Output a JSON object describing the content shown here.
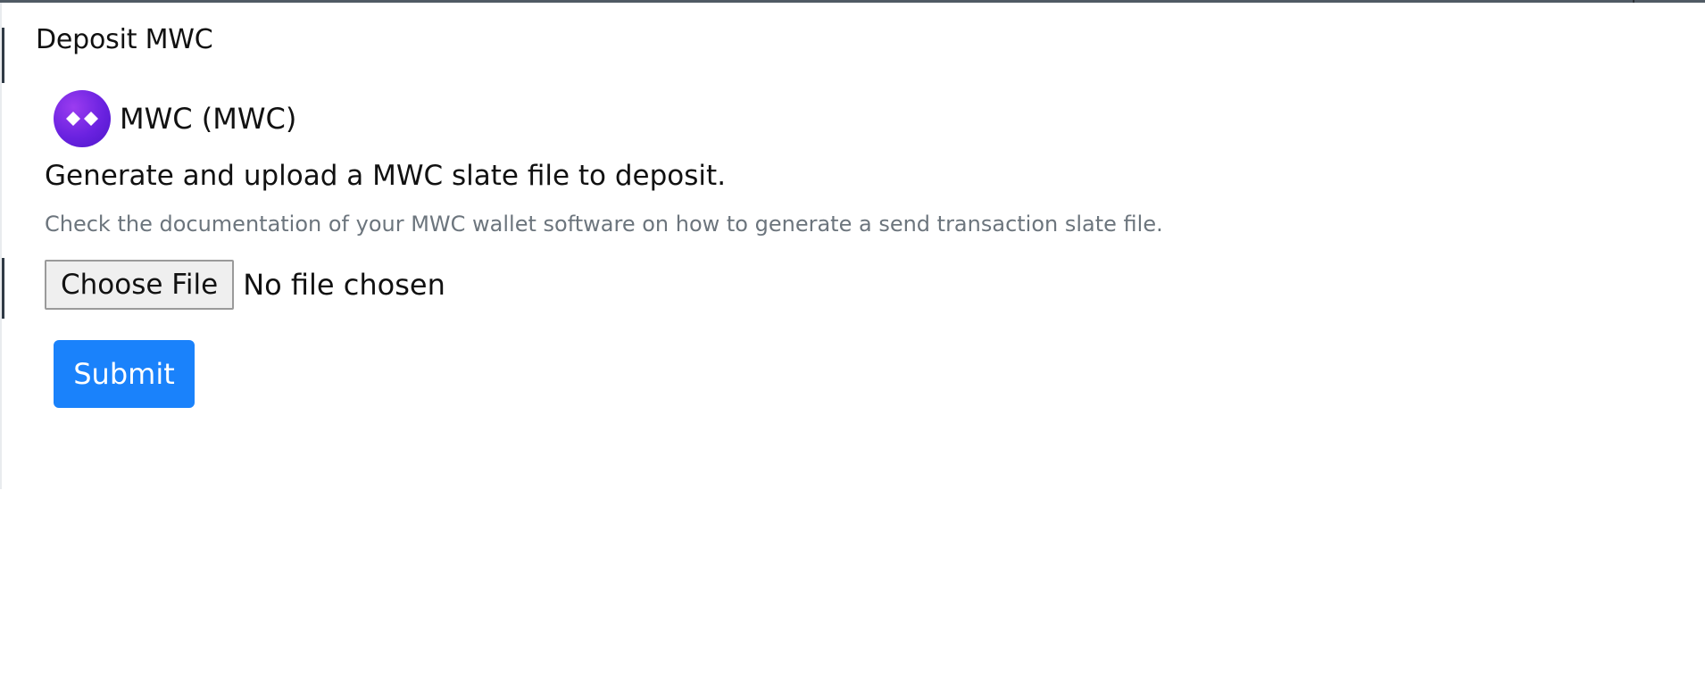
{
  "colors": {
    "accent": "#1a82fb",
    "coin_gradient_start": "#9b3cf0",
    "coin_gradient_end": "#4d17c9",
    "muted_text": "#6c757d"
  },
  "deposit": {
    "title": "Deposit MWC",
    "coin": {
      "icon": "mwc-logo-icon",
      "name": "MWC (MWC)"
    },
    "heading": "Generate and upload a MWC slate file to deposit.",
    "help_text": "Check the documentation of your MWC wallet software on how to generate a send transaction slate file.",
    "file_input": {
      "button_label": "Choose File",
      "status": "No file chosen"
    },
    "submit_label": "Submit"
  }
}
